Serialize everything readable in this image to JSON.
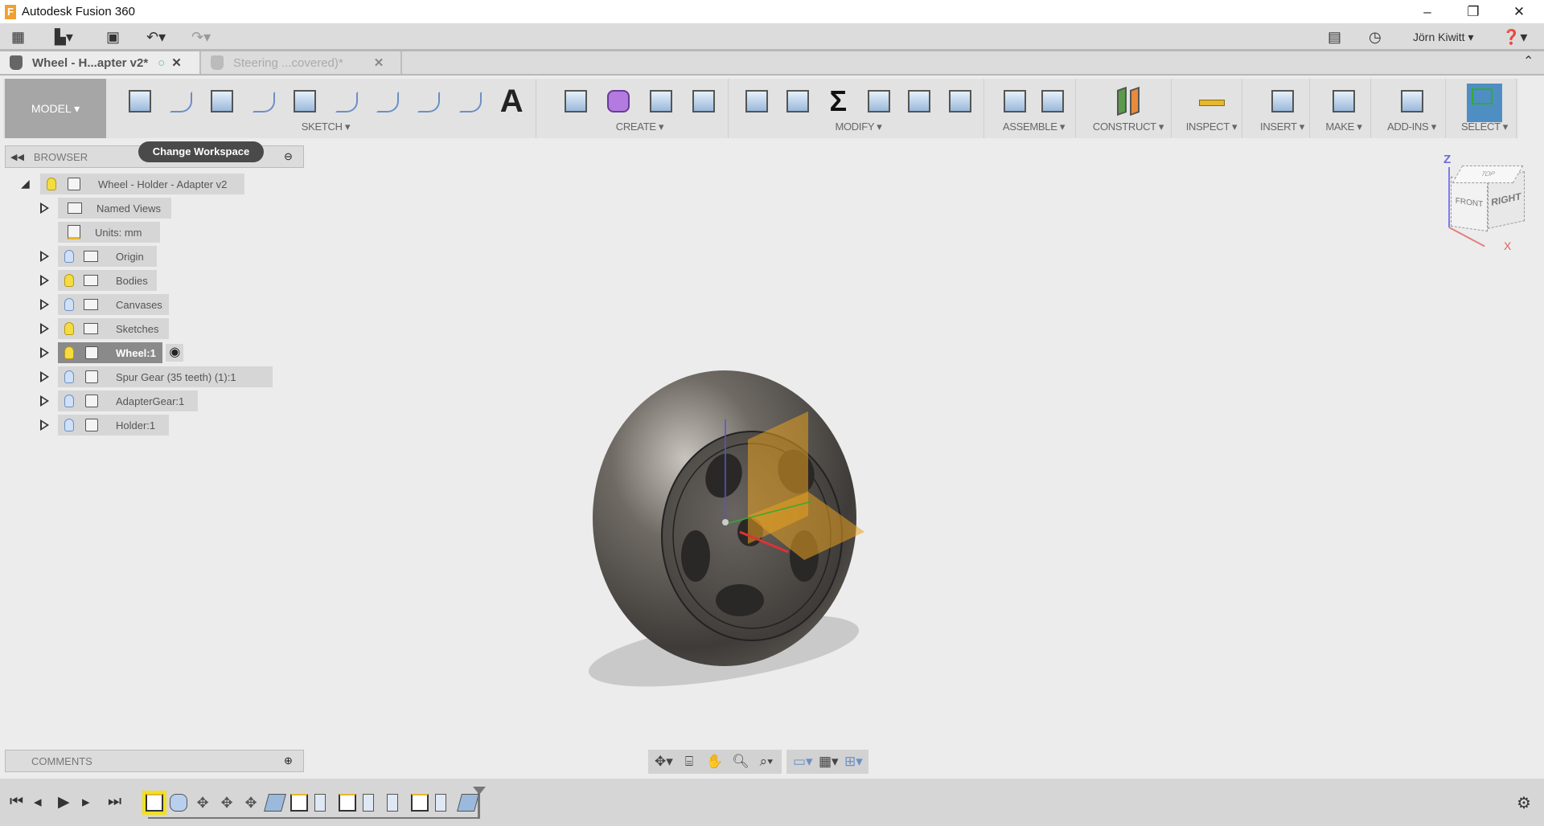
{
  "app": {
    "title": "Autodesk Fusion 360",
    "logo_letter": "F"
  },
  "window_controls": {
    "minimize": "–",
    "restore": "❐",
    "close": "✕"
  },
  "quick_access": {
    "user": "Jörn Kiwitt ▾",
    "icons": [
      "apps-grid-icon",
      "file-icon",
      "save-icon",
      "undo-icon",
      "redo-icon",
      "comments-icon",
      "job-status-icon",
      "help-icon"
    ]
  },
  "tabs": [
    {
      "label": "Wheel - H...apter v2*",
      "active": true
    },
    {
      "label": "Steering ...covered)*",
      "active": false
    }
  ],
  "ribbon": {
    "workspace": "MODEL ▾",
    "groups": [
      {
        "label": "SKETCH ▾",
        "tools": [
          "create-sketch",
          "line",
          "rectangle",
          "construction-line",
          "center-rectangle",
          "spline",
          "mirror",
          "arc",
          "sketch-fillet",
          "text"
        ]
      },
      {
        "label": "CREATE ▾",
        "tools": [
          "extrude",
          "create-form",
          "revolve",
          "pattern"
        ]
      },
      {
        "label": "MODIFY ▾",
        "tools": [
          "press-pull",
          "fillet",
          "change-parameters",
          "split-body",
          "chamfer",
          "move"
        ]
      },
      {
        "label": "ASSEMBLE ▾",
        "tools": [
          "new-component",
          "joint"
        ]
      },
      {
        "label": "CONSTRUCT ▾",
        "tools": [
          "offset-plane"
        ]
      },
      {
        "label": "INSPECT ▾",
        "tools": [
          "measure"
        ]
      },
      {
        "label": "INSERT ▾",
        "tools": [
          "canvas"
        ]
      },
      {
        "label": "MAKE ▾",
        "tools": [
          "3d-print"
        ]
      },
      {
        "label": "ADD-INS ▾",
        "tools": [
          "scripts"
        ]
      },
      {
        "label": "SELECT ▾",
        "tools": [
          "select"
        ]
      }
    ]
  },
  "tooltip": "Change Workspace",
  "browser": {
    "title": "BROWSER",
    "root": "Wheel - Holder - Adapter v2",
    "items": [
      {
        "label": "Named Views",
        "bulb": null,
        "icon": "folder"
      },
      {
        "label": "Units: mm",
        "bulb": null,
        "icon": "document"
      },
      {
        "label": "Origin",
        "bulb": "off",
        "icon": "folder"
      },
      {
        "label": "Bodies",
        "bulb": "on",
        "icon": "folder"
      },
      {
        "label": "Canvases",
        "bulb": "off",
        "icon": "folder"
      },
      {
        "label": "Sketches",
        "bulb": "on",
        "icon": "folder"
      },
      {
        "label": "Wheel:1",
        "bulb": "on",
        "icon": "component",
        "active": true
      },
      {
        "label": "Spur Gear (35 teeth) (1):1",
        "bulb": "off",
        "icon": "component"
      },
      {
        "label": "AdapterGear:1",
        "bulb": "off",
        "icon": "component"
      },
      {
        "label": "Holder:1",
        "bulb": "off",
        "icon": "assembly"
      }
    ]
  },
  "comments": {
    "title": "COMMENTS"
  },
  "viewcube": {
    "front": "FRONT",
    "right": "RIGHT",
    "top": "TOP",
    "z": "Z",
    "x": "X"
  },
  "navbar": {
    "icons": [
      "orbit-icon",
      "look-at-icon",
      "pan-icon",
      "zoom-icon",
      "fit-icon",
      "display-settings-icon",
      "grid-icon",
      "viewports-icon"
    ]
  },
  "timeline": {
    "features": [
      "sketch",
      "revolve",
      "move",
      "move",
      "move",
      "combine",
      "sketch",
      "extrude",
      "sketch",
      "extrude",
      "extrude",
      "sketch",
      "extrude",
      "combine"
    ]
  }
}
